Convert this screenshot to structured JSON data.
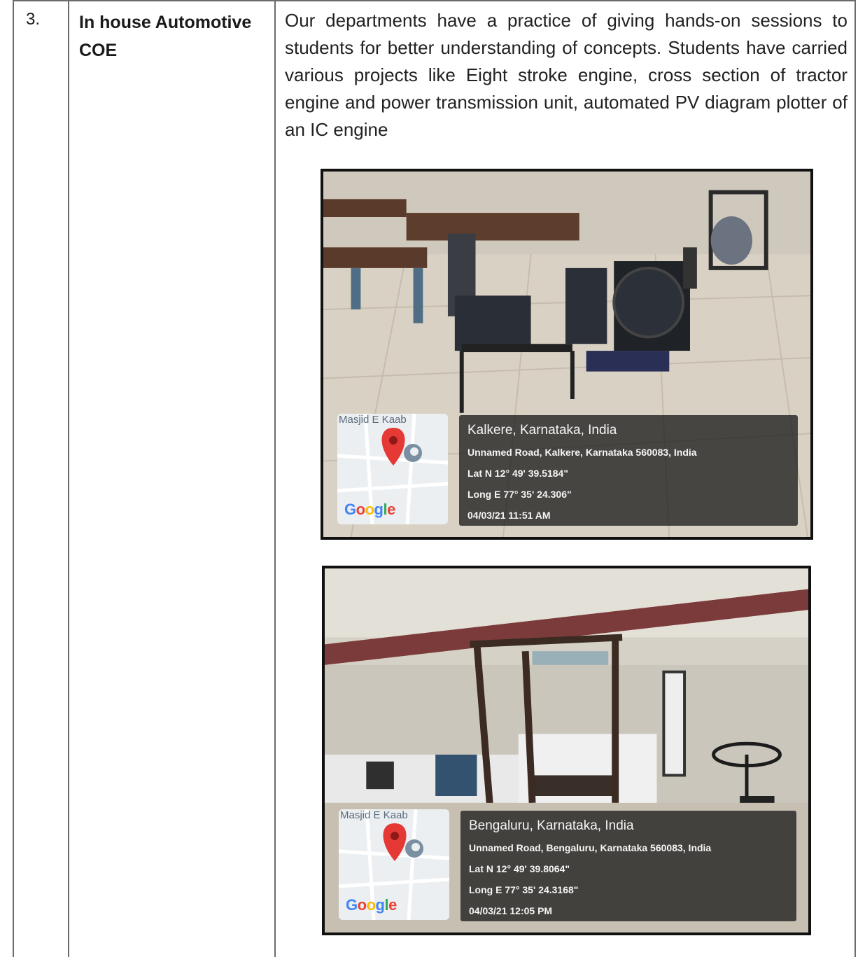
{
  "row": {
    "number": "3.",
    "title": "In house Automotive COE",
    "description": "Our departments have a practice of giving hands-on sessions to students for better understanding of concepts. Students have carried various projects like Eight stroke engine, cross section of tractor engine and power transmission unit, automated PV diagram plotter of an IC engine"
  },
  "photos": [
    {
      "map_place": "Masjid E Kaab",
      "map_brand": "Google",
      "city": "Kalkere, Karnataka, India",
      "address": "Unnamed Road, Kalkere, Karnataka 560083, India",
      "lat": "Lat N 12° 49' 39.5184\"",
      "long": "Long E 77° 35' 24.306\"",
      "datetime": "04/03/21 11:51 AM"
    },
    {
      "map_place": "Masjid E Kaab",
      "map_brand": "Google",
      "city": "Bengaluru, Karnataka, India",
      "address": "Unnamed Road, Bengaluru, Karnataka 560083, India",
      "lat": "Lat N 12° 49' 39.8064\"",
      "long": "Long E 77° 35' 24.3168\"",
      "datetime": "04/03/21 12:05 PM"
    }
  ],
  "colors": {
    "border": "#6b6b6b",
    "pin": "#e53935",
    "overlay": "#1e1e1e"
  }
}
